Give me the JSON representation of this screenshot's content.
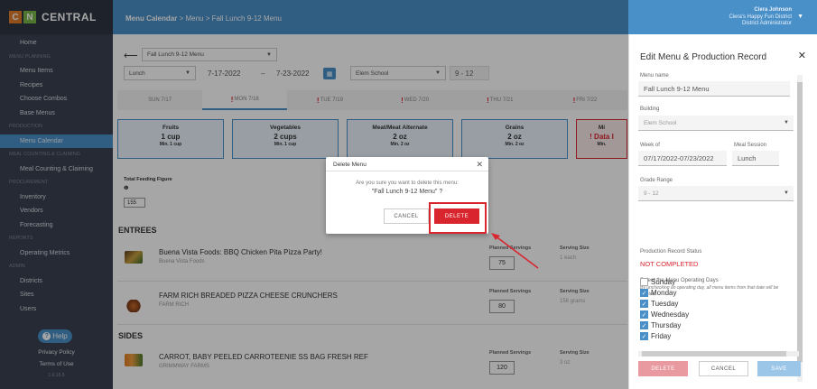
{
  "app": {
    "brand_c": "C",
    "brand_n": "N",
    "brand_name": "CENTRAL"
  },
  "sidebar": {
    "rows": [
      {
        "label": "Home",
        "type": "item"
      },
      {
        "label": "MENU PLANNING",
        "type": "section"
      },
      {
        "label": "Menu Items",
        "type": "item"
      },
      {
        "label": "Recipes",
        "type": "item"
      },
      {
        "label": "Choose Combos",
        "type": "item"
      },
      {
        "label": "Base Menus",
        "type": "item"
      },
      {
        "label": "PRODUCTION",
        "type": "section"
      },
      {
        "label": "Menu Calendar",
        "type": "item",
        "active": true
      },
      {
        "label": "MEAL COUNTING & CLAIMING",
        "type": "section"
      },
      {
        "label": "Meal Counting & Claiming",
        "type": "item"
      },
      {
        "label": "PROCUREMENT",
        "type": "section"
      },
      {
        "label": "Inventory",
        "type": "item"
      },
      {
        "label": "Vendors",
        "type": "item"
      },
      {
        "label": "Forecasting",
        "type": "item"
      },
      {
        "label": "REPORTS",
        "type": "section"
      },
      {
        "label": "Operating Metrics",
        "type": "item"
      },
      {
        "label": "ADMIN",
        "type": "section"
      },
      {
        "label": "Districts",
        "type": "item"
      },
      {
        "label": "Sites",
        "type": "item"
      },
      {
        "label": "Users",
        "type": "item"
      }
    ],
    "help_label": "Help",
    "privacy": "Privacy Policy",
    "terms": "Terms of Use",
    "version": "1.6.16.5"
  },
  "header": {
    "crumb_root": "Menu Calendar",
    "crumb_rest": " > Menu > Fall Lunch 9-12 Menu",
    "user_name": "Ciera Johnson",
    "user_district": "Ciera's Happy Fun District",
    "user_role": "District Administrator"
  },
  "filters": {
    "menu": "Fall Lunch 9-12 Menu",
    "meal": "Lunch",
    "date_from": "7-17-2022",
    "date_sep": "–",
    "date_to": "7-23-2022",
    "school": "Elem School",
    "grade": "9 - 12"
  },
  "days": [
    {
      "label": "SUN 7/17",
      "warn": false
    },
    {
      "label": "MON 7/18",
      "warn": true,
      "active": true
    },
    {
      "label": "TUE 7/19",
      "warn": true
    },
    {
      "label": "WED 7/20",
      "warn": true
    },
    {
      "label": "THU 7/21",
      "warn": true
    },
    {
      "label": "FRI 7/22",
      "warn": true
    }
  ],
  "components": [
    {
      "name": "Fruits",
      "value": "1 cup",
      "min": "Min. 1 cup"
    },
    {
      "name": "Vegetables",
      "value": "2 cups",
      "min": "Min. 1 cup"
    },
    {
      "name": "Meat/Meat Alternate",
      "value": "2 oz",
      "min": "Min. 2 oz"
    },
    {
      "name": "Grains",
      "value": "2 oz",
      "min": "Min. 2 oz"
    },
    {
      "name": "Mi",
      "value": "! Data I",
      "min": "Min."
    }
  ],
  "feeding": {
    "label": "Total Feeding Figure",
    "value": "155"
  },
  "sections": {
    "entrees": "ENTREES",
    "sides": "SIDES"
  },
  "columns": {
    "planned": "Planned Servings",
    "serving": "Serving Size"
  },
  "items": [
    {
      "name": "Buena Vista Foods: BBQ Chicken Pita Pizza Party!",
      "vendor": "Buena Vista Foods",
      "planned": "75",
      "serving": "1 each"
    },
    {
      "name": "FARM RICH BREADED PIZZA CHEESE CRUNCHERS",
      "vendor": "FARM RICH",
      "planned": "80",
      "serving": "156 grams"
    },
    {
      "name": "CARROT, BABY PEELED CARROTEENIE SS BAG FRESH REF",
      "vendor": "GRIMMWAY FARMS",
      "planned": "120",
      "serving": "3 oz"
    }
  ],
  "dialog": {
    "title": "Delete Menu",
    "message": "Are you sure you want to delete this menu:",
    "menu_name": "\"Fall Lunch 9-12 Menu\" ?",
    "cancel": "CANCEL",
    "delete": "DELETE"
  },
  "panel": {
    "title": "Edit Menu & Production Record",
    "menu_name_label": "Menu name",
    "menu_name": "Fall Lunch 9-12 Menu",
    "building_label": "Building",
    "building": "Elem School",
    "week_label": "Week of",
    "week": "07/17/2022-07/23/2022",
    "session_label": "Meal Session",
    "session": "Lunch",
    "grade_label": "Grade Range",
    "grade": "9 - 12",
    "status_label": "Production Record Status",
    "status": "NOT COMPLETED",
    "days_label": "Select the Menu Operating Days",
    "days_note": "By unchecking an operating day, all menu items from that date will be deleted.",
    "operating_days": [
      {
        "label": "Sunday",
        "checked": false
      },
      {
        "label": "Monday",
        "checked": true
      },
      {
        "label": "Tuesday",
        "checked": true
      },
      {
        "label": "Wednesday",
        "checked": true
      },
      {
        "label": "Thursday",
        "checked": true
      },
      {
        "label": "Friday",
        "checked": true
      }
    ],
    "delete_btn": "DELETE",
    "cancel_btn": "CANCEL",
    "save_btn": "SAVE"
  },
  "colors": {
    "primary": "#4a90c8",
    "sidebar": "#3a4150",
    "danger": "#d9252e"
  }
}
